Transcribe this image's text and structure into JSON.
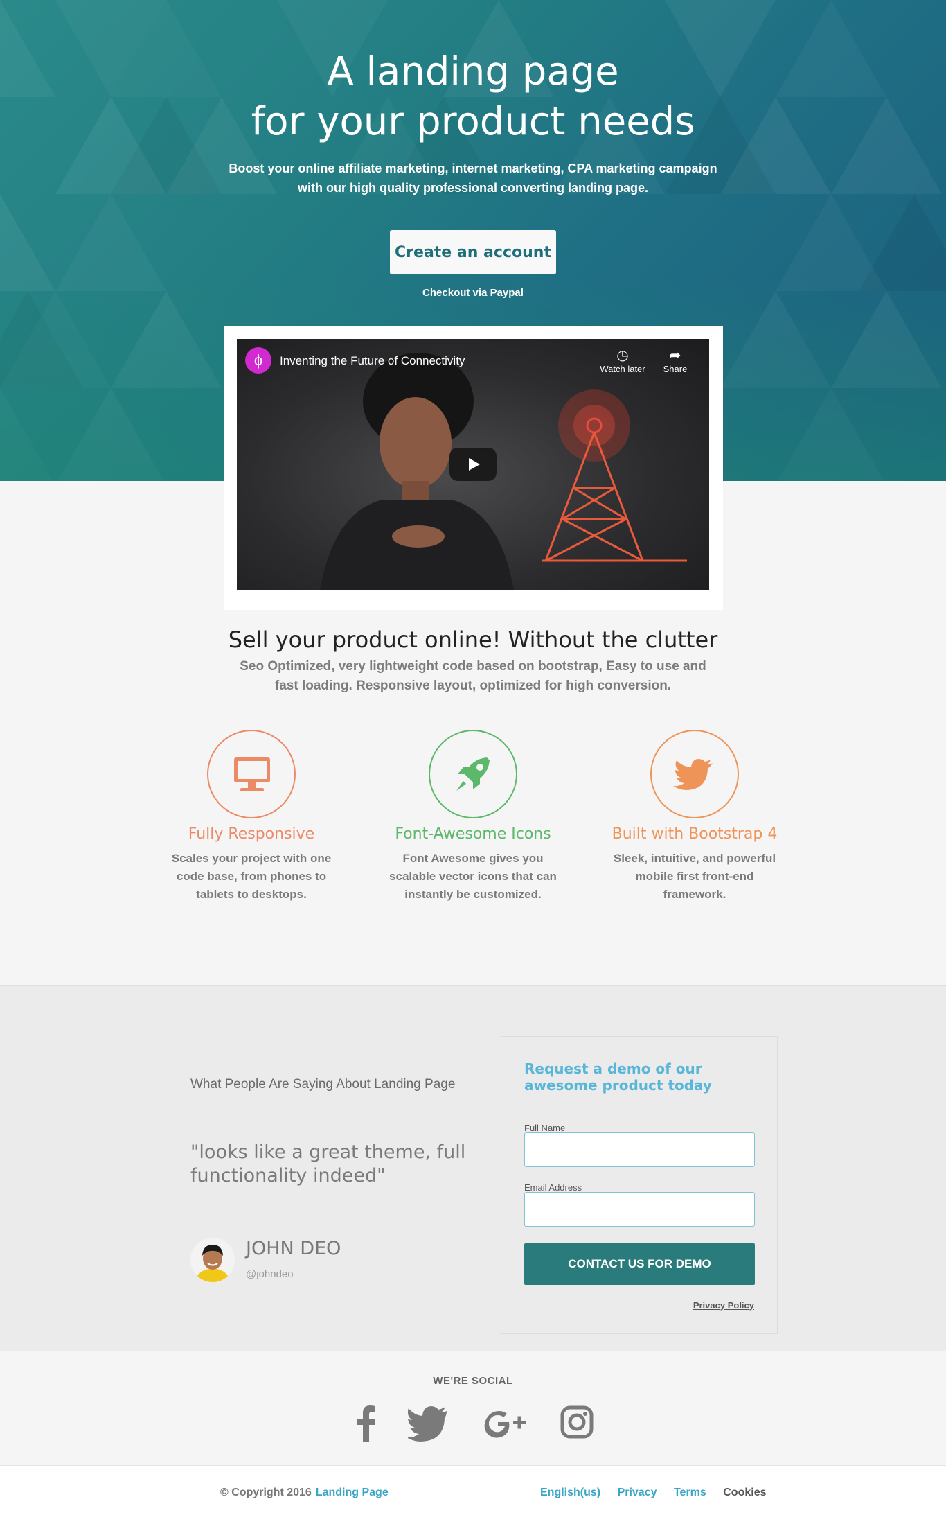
{
  "hero": {
    "title_line1": "A landing page",
    "title_line2": "for your product needs",
    "subtitle_line1": "Boost your online affiliate marketing, internet marketing, CPA marketing campaign",
    "subtitle_line2": "with our high quality professional converting landing page.",
    "cta_label": "Create an account",
    "checkout_label": "Checkout via Paypal"
  },
  "video": {
    "title": "Inventing the Future of Connectivity",
    "watch_later": "Watch later",
    "share": "Share"
  },
  "features": {
    "title": "Sell your product online! Without the clutter",
    "subtitle": "Seo Optimized, very lightweight code based on bootstrap, Easy to use and fast loading. Responsive layout, optimized for high conversion.",
    "items": [
      {
        "title": "Fully Responsive",
        "text": "Scales your project with one code base, from phones to tablets to desktops.",
        "icon": "desktop-icon",
        "color": "#ec8a66"
      },
      {
        "title": "Font-Awesome Icons",
        "text": "Font Awesome gives you scalable vector icons that can instantly be customized.",
        "icon": "rocket-icon",
        "color": "#5cb86a"
      },
      {
        "title": "Built with Bootstrap 4",
        "text": "Sleek, intuitive, and powerful mobile first front-end framework.",
        "icon": "twitter-icon",
        "color": "#ef9459"
      }
    ]
  },
  "testimonial": {
    "heading": "What People Are Saying About Landing Page",
    "quote": "\"looks like a great theme, full functionality indeed\"",
    "author": "JOHN DEO",
    "handle": "@johndeo"
  },
  "demo_form": {
    "title": "Request a demo of our awesome product today",
    "name_label": "Full Name",
    "name_value": "",
    "email_label": "Email Address",
    "email_value": "",
    "submit_label": "CONTACT US FOR DEMO",
    "privacy_label": "Privacy Policy"
  },
  "social": {
    "title": "WE'RE SOCIAL",
    "icons": [
      "facebook-icon",
      "twitter-icon",
      "google-plus-icon",
      "instagram-icon"
    ]
  },
  "footer": {
    "copyright": "© Copyright 2016",
    "brand_link": "Landing Page",
    "links": [
      "English(us)",
      "Privacy",
      "Terms",
      "Cookies"
    ]
  },
  "colors": {
    "accent": "#2a7b7b",
    "link": "#3aa6c7",
    "demo_title": "#58b6d8"
  }
}
